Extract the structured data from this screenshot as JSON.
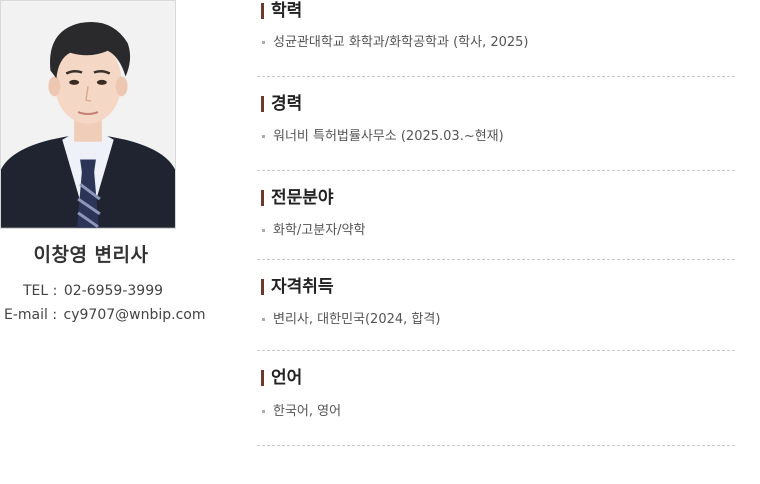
{
  "profile": {
    "name": "이창영 변리사",
    "tel_label": "TEL :",
    "tel": "02-6959-3999",
    "email_label": "E-mail :",
    "email": "cy9707@wnbip.com"
  },
  "sections": [
    {
      "title": "학력",
      "items": [
        "성균관대학교 화학과/화학공학과 (학사, 2025)"
      ]
    },
    {
      "title": "경력",
      "items": [
        "워너비 특허법률사무소 (2025.03.~현재)"
      ]
    },
    {
      "title": "전문분야",
      "items": [
        "화학/고분자/약학"
      ]
    },
    {
      "title": "자격취득",
      "items": [
        "변리사, 대한민국(2024, 합격)"
      ]
    },
    {
      "title": "언어",
      "items": [
        "한국어, 영어"
      ]
    }
  ],
  "colors": {
    "accent_bar": "#6b3a2a",
    "divider": "#c9c9c9"
  }
}
